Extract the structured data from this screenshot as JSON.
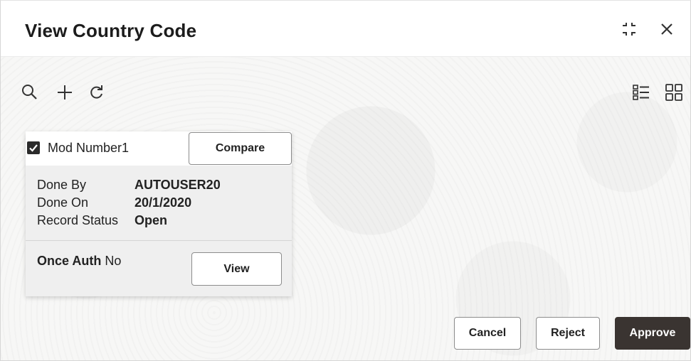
{
  "window": {
    "title": "View Country Code"
  },
  "toolbar": {
    "left_icons": [
      "search-icon",
      "add-icon",
      "refresh-icon"
    ],
    "right_icons": [
      "list-view-icon",
      "grid-view-icon"
    ]
  },
  "card": {
    "checked": true,
    "mod_label": "Mod Number1",
    "compare_label": "Compare",
    "details": [
      {
        "label": "Done By",
        "value": "AUTOUSER20"
      },
      {
        "label": "Done On",
        "value": "20/1/2020"
      },
      {
        "label": "Record Status",
        "value": "Open"
      }
    ],
    "once_auth_label": "Once Auth",
    "once_auth_value": "No",
    "view_label": "View"
  },
  "footer": {
    "cancel_label": "Cancel",
    "reject_label": "Reject",
    "approve_label": "Approve"
  },
  "colors": {
    "approve_bg": "#3a3431",
    "approve_text": "#ffffff"
  }
}
